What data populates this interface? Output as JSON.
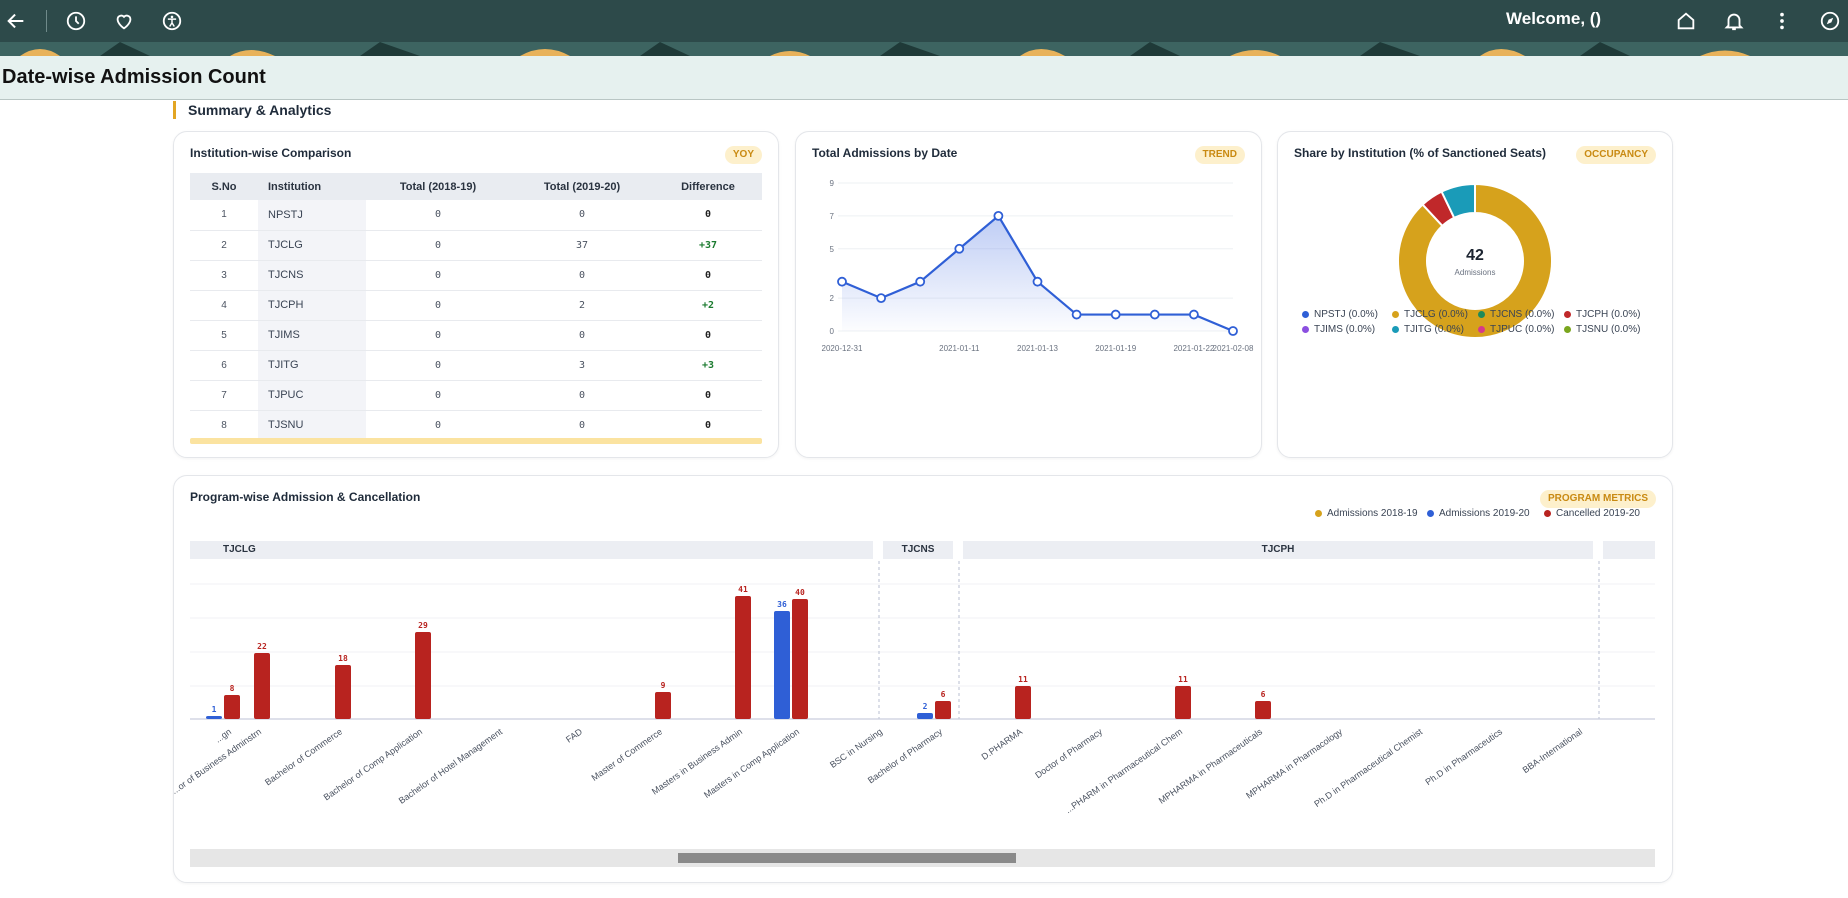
{
  "topbar": {
    "welcome": "Welcome, ()",
    "icons": [
      "back-arrow-icon",
      "history-icon",
      "heart-icon",
      "accessibility-icon",
      "home-icon",
      "bell-icon",
      "more-vertical-icon",
      "compass-icon"
    ]
  },
  "page": {
    "title": "Date-wise Admission Count"
  },
  "section": {
    "heading": "Summary & Analytics"
  },
  "comparison": {
    "title": "Institution-wise Comparison",
    "badge": "YOY",
    "headers": [
      "S.No",
      "Institution",
      "Total (2018-19)",
      "Total (2019-20)",
      "Difference"
    ],
    "rows": [
      {
        "sno": "1",
        "inst": "NPSTJ",
        "t1": "0",
        "t2": "0",
        "diff": "0"
      },
      {
        "sno": "2",
        "inst": "TJCLG",
        "t1": "0",
        "t2": "37",
        "diff": "+37"
      },
      {
        "sno": "3",
        "inst": "TJCNS",
        "t1": "0",
        "t2": "0",
        "diff": "0"
      },
      {
        "sno": "4",
        "inst": "TJCPH",
        "t1": "0",
        "t2": "2",
        "diff": "+2"
      },
      {
        "sno": "5",
        "inst": "TJIMS",
        "t1": "0",
        "t2": "0",
        "diff": "0"
      },
      {
        "sno": "6",
        "inst": "TJITG",
        "t1": "0",
        "t2": "3",
        "diff": "+3"
      },
      {
        "sno": "7",
        "inst": "TJPUC",
        "t1": "0",
        "t2": "0",
        "diff": "0"
      },
      {
        "sno": "8",
        "inst": "TJSNU",
        "t1": "0",
        "t2": "0",
        "diff": "0"
      }
    ]
  },
  "trend": {
    "title": "Total Admissions by Date",
    "badge": "TREND"
  },
  "share": {
    "title": "Share by Institution (% of Sanctioned Seats)",
    "badge": "OCCUPANCY",
    "center_value": "42",
    "center_label": "Admissions",
    "legend": [
      {
        "label": "NPSTJ (0.0%)",
        "color": "#2f5fd6"
      },
      {
        "label": "TJCLG (0.0%)",
        "color": "#d6a21c"
      },
      {
        "label": "TJCNS (0.0%)",
        "color": "#1e8a5a"
      },
      {
        "label": "TJCPH (0.0%)",
        "color": "#c0282a"
      },
      {
        "label": "TJIMS (0.0%)",
        "color": "#8b4fe0"
      },
      {
        "label": "TJITG (0.0%)",
        "color": "#1a9bb8"
      },
      {
        "label": "TJPUC (0.0%)",
        "color": "#d63a8a"
      },
      {
        "label": "TJSNU (0.0%)",
        "color": "#7aa61e"
      }
    ]
  },
  "program": {
    "title": "Program-wise Admission & Cancellation",
    "badge": "PROGRAM METRICS",
    "legend": [
      {
        "label": "Admissions 2018-19",
        "color": "#d6a21c"
      },
      {
        "label": "Admissions 2019-20",
        "color": "#2f5fd6"
      },
      {
        "label": "Cancelled 2019-20",
        "color": "#b8231f"
      }
    ],
    "groups": [
      "TJCLG",
      "TJCNS",
      "TJCPH"
    ]
  },
  "chart_data": [
    {
      "type": "line",
      "title": "Total Admissions by Date",
      "x": [
        "2020-12-31",
        "2021-01-04",
        "2021-01-08",
        "2021-01-11",
        "2021-01-12",
        "2021-01-13",
        "2021-01-15",
        "2021-01-19",
        "2021-01-20",
        "2021-01-22",
        "2021-02-08"
      ],
      "values": [
        3,
        2,
        3,
        5,
        7,
        3,
        1,
        1,
        1,
        1,
        0
      ],
      "ytick_labels": [
        "0",
        "2",
        "5",
        "7",
        "9"
      ],
      "xtick_labels": [
        "2020-12-31",
        "2021-01-11",
        "2021-01-13",
        "2021-01-19",
        "2021-01-22",
        "2021-02-08"
      ],
      "ylim": [
        0,
        9
      ]
    },
    {
      "type": "pie",
      "title": "Share by Institution (% of Sanctioned Seats)",
      "labels": [
        "TJCLG",
        "TJCPH",
        "TJITG"
      ],
      "values": [
        37,
        2,
        3
      ],
      "colors": [
        "#d6a21c",
        "#c0282a",
        "#1a9bb8"
      ]
    },
    {
      "type": "bar",
      "title": "Program-wise Admission & Cancellation",
      "categories": [
        "...gn",
        "...or of Business Adminstrn",
        "Bachelor of Commerce",
        "Bachelor of Comp Application",
        "Bachelor of Hotel Management",
        "FAD",
        "Master of Commerce",
        "Masters in Business Admin",
        "Masters in Comp Application",
        "BSC in Nursing",
        "Bachelor of Pharmacy",
        "D.PHARMA",
        "Doctor of Pharmacy",
        "...PHARM in Pharmaceutical Chem",
        "MPHARMA in Pharmaceuticals",
        "MPHARMA in Pharmacology",
        "Ph.D in Pharmaceutical Chemist",
        "Ph.D in Pharmaceutics",
        "BBA-International"
      ],
      "series": [
        {
          "name": "Admissions 2019-20",
          "values": [
            1,
            0,
            0,
            0,
            0,
            0,
            0,
            0,
            36,
            0,
            2,
            0,
            0,
            0,
            0,
            0,
            0,
            0,
            0
          ]
        },
        {
          "name": "Cancelled 2019-20",
          "values": [
            8,
            22,
            18,
            29,
            0,
            0,
            9,
            41,
            40,
            0,
            6,
            11,
            0,
            11,
            6,
            0,
            0,
            0,
            0
          ]
        }
      ]
    }
  ]
}
